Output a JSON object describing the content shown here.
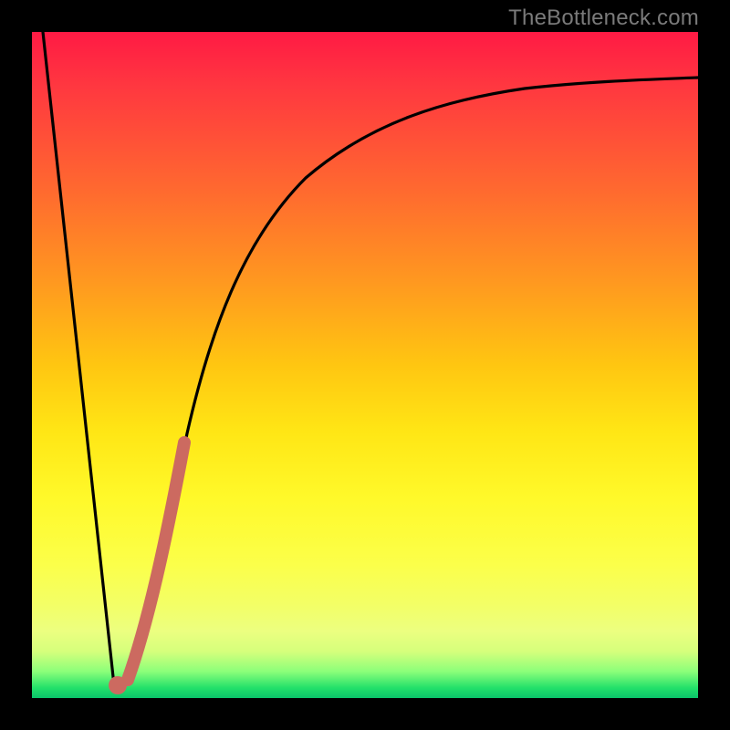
{
  "watermark": "TheBottleneck.com",
  "colors": {
    "frame": "#000000",
    "curve": "#000000",
    "highlight": "#cc6a60",
    "highlight_dot": "#cc6a60"
  },
  "chart_data": {
    "type": "line",
    "title": "",
    "xlabel": "",
    "ylabel": "",
    "xlim": [
      0,
      100
    ],
    "ylim": [
      0,
      100
    ],
    "grid": false,
    "legend": false,
    "series": [
      {
        "name": "bottleneck-curve",
        "x": [
          0,
          2,
          4,
          6,
          8,
          10,
          11,
          12,
          13,
          14,
          16,
          18,
          20,
          22,
          25,
          30,
          35,
          40,
          45,
          50,
          55,
          60,
          65,
          70,
          75,
          80,
          85,
          90,
          95,
          100
        ],
        "y": [
          100,
          82,
          64,
          46,
          28,
          10,
          3,
          0,
          3,
          10,
          24,
          36,
          46,
          53,
          60,
          68,
          74,
          78,
          81,
          83.5,
          85.5,
          87,
          88.2,
          89.2,
          90,
          90.7,
          91.3,
          91.8,
          92.2,
          92.5
        ]
      }
    ],
    "highlight_segment": {
      "series": "bottleneck-curve",
      "x_start": 12,
      "x_end": 20,
      "stroke_width_px": 14
    },
    "highlight_dot": {
      "x": 12,
      "y": 0,
      "radius_px": 10
    },
    "notes": "y-values expressed as percent of plot height from bottom; x as percent of plot width"
  }
}
